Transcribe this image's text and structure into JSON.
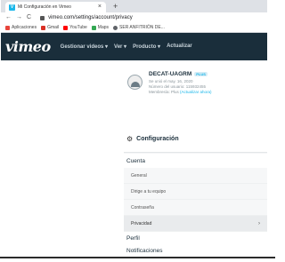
{
  "browser": {
    "tab_title": "Mi Configuración en Vimeo",
    "tab_close": "×",
    "new_tab": "+",
    "nav": {
      "back": "←",
      "forward": "→",
      "reload": "C"
    },
    "url": "vimeo.com/settings/account/privacy",
    "bookmarks": [
      {
        "label": "Aplicaciones",
        "color": "#e8453c"
      },
      {
        "label": "Gmail",
        "color": "#d93025"
      },
      {
        "label": "YouTube",
        "color": "#ff0000"
      },
      {
        "label": "Maps",
        "color": "#34a853"
      },
      {
        "label": "SER ANFITRIÓN DE...",
        "color": "#5f6368"
      }
    ]
  },
  "vimeo": {
    "logo": "vimeo",
    "menu": [
      "Gestionar videos ▾",
      "Ver ▾",
      "Producto ▾",
      "Actualizar"
    ]
  },
  "profile": {
    "username": "DECAT-UAGRM",
    "badge": "PLUS",
    "joined": "Se unió el may. 16, 2020",
    "user_number": "Número del usuario: 115932455",
    "membership": "Membresía: Plus",
    "upgrade_link": "(Actualizar ahora)"
  },
  "settings": {
    "title": "Configuración",
    "sections": {
      "account": "Cuenta",
      "account_items": [
        "General",
        "Dirige a tu equipo",
        "Contraseña",
        "Privacidad"
      ],
      "active_item": "Privacidad",
      "profile": "Perfil",
      "notifications": "Notificaciones"
    },
    "chevron": "›"
  },
  "colors": {
    "vimeo_header": "#1a2e3b",
    "vimeo_blue": "#1ab7ea",
    "panel_bg": "#f4f5f6"
  }
}
